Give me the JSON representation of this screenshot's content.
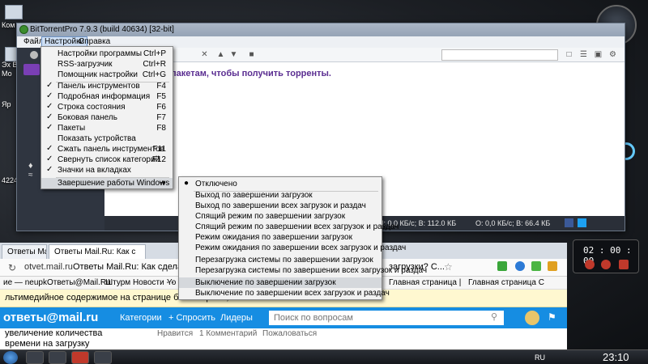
{
  "desktop": {
    "labels": [
      "Ком",
      "Эх В",
      "Мо",
      "Яр",
      "4224"
    ]
  },
  "window": {
    "title": "BitTorrentPro 7.9.3  (build 40634) [32-bit]",
    "menubar": [
      "Файл",
      "Настройки",
      "Справка"
    ],
    "content_text": "пакетам, чтобы получить торренты.",
    "status": {
      "left": "П: 0,0 КБ/с; В: 112.0 КБ",
      "right": "О: 0,0 КБ/с; В: 66.4 КБ"
    }
  },
  "settings_menu": {
    "items": [
      {
        "label": "Настройки программы",
        "shortcut": "Ctrl+P",
        "checked": false
      },
      {
        "label": "RSS-загрузчик",
        "shortcut": "Ctrl+R",
        "checked": false
      },
      {
        "label": "Помощник настройки",
        "shortcut": "Ctrl+G",
        "checked": false
      },
      {
        "label": "Панель инструментов",
        "shortcut": "F4",
        "checked": true
      },
      {
        "label": "Подробная информация",
        "shortcut": "F5",
        "checked": true
      },
      {
        "label": "Строка состояния",
        "shortcut": "F6",
        "checked": true
      },
      {
        "label": "Боковая панель",
        "shortcut": "F7",
        "checked": true
      },
      {
        "label": "Пакеты",
        "shortcut": "F8",
        "checked": true
      },
      {
        "label": "Показать устройства",
        "shortcut": "",
        "checked": false
      },
      {
        "label": "Сжать панель инструментов",
        "shortcut": "F11",
        "checked": true
      },
      {
        "label": "Свернуть список категорий",
        "shortcut": "F12",
        "checked": true
      },
      {
        "label": "Значки на вкладках",
        "shortcut": "",
        "checked": true
      },
      {
        "label": "Завершение работы Windows",
        "shortcut": "",
        "checked": false
      }
    ]
  },
  "shutdown_menu": {
    "items": [
      "Отключено",
      "Выход по завершении загрузок",
      "Выход по завершении всех загрузок и раздач",
      "Спящий режим по завершении загрузок",
      "Спящий режим по завершении всех загрузок и раздач",
      "Режим ожидания по завершении загрузок",
      "Режим ожидания по завершении всех загрузок и раздач",
      "Перезагрузка системы по завершении загрузок",
      "Перезагрузка системы по завершении всех загрузок и раздач",
      "Выключение по завершении загрузок",
      "Выключение по завершении всех загрузок и раздач"
    ]
  },
  "browser": {
    "tabs": [
      "Ответы Mail.Ru",
      "Ответы Mail.Ru: Как с"
    ],
    "address": "otvet.mail.ru",
    "page_title": "Ответы Mail.Ru: Как сделать в",
    "page_title_right": "загрузки? С...",
    "bookmarks": [
      "ие — neupk",
      "Ответы@Mail.Ru",
      "Штурм Новости - -",
      "Yo",
      "Главная страница |",
      "Главная страница С"
    ],
    "notice": "льтимедийное содержимое на странице было скрыто,",
    "mail_logo": "ответы@mail.ru",
    "nav": [
      "Категории",
      "+ Спросить",
      "Лидеры"
    ],
    "search_placeholder": "Поиск по вопросам",
    "side_text": [
      "увеличение количества",
      "времени на загрузку"
    ],
    "actions": [
      "Нравится",
      "1 Комментарий",
      "Пожаловаться"
    ]
  },
  "timer": {
    "value": "02 : 00 : 00"
  },
  "taskbar": {
    "lang": "RU",
    "clock": "23:10"
  },
  "colors": {
    "mail_blue": "#168de2",
    "accent_purple": "#5a2d91",
    "menu_highlight": "#d5d8dc"
  }
}
